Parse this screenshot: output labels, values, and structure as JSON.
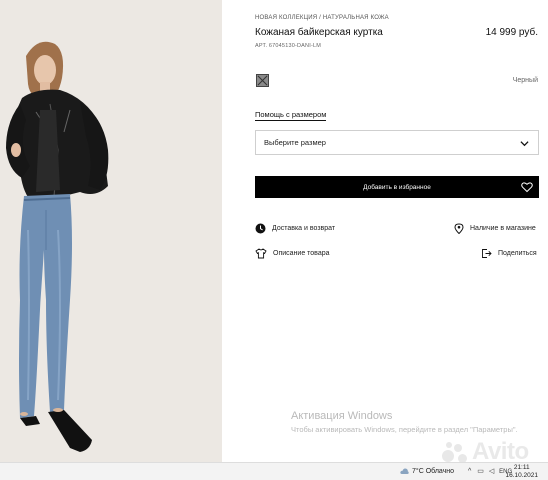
{
  "product": {
    "breadcrumb": "НОВАЯ КОЛЛЕКЦИЯ / НАТУРАЛЬНАЯ КОЖА",
    "title": "Кожаная байкерская куртка",
    "price": "14 999 руб.",
    "article": "АРТ. 67045130-DANI-LM",
    "color_name": "Черный"
  },
  "size": {
    "help_link": "Помощь с размером",
    "select_placeholder": "Выберите размер"
  },
  "actions": {
    "add_to_favorites": "Добавить в избранное"
  },
  "info": {
    "delivery": "Доставка и возврат",
    "in_store": "Наличие в магазине",
    "description": "Описание товара",
    "share": "Поделиться"
  },
  "watermark": {
    "line1": "Активация Windows",
    "line2": "Чтобы активировать Windows, перейдите в раздел \"Параметры\"."
  },
  "avito_logo": "Avito",
  "taskbar": {
    "weather": "7°C  Облачно",
    "lang": "ENG",
    "time": "21:11",
    "date": "16.10.2021"
  },
  "colors": {
    "button_bg": "#000000",
    "photo_bg": "#ece8e3",
    "jeans": "#6f8fb4",
    "jacket": "#1a1a1a"
  }
}
